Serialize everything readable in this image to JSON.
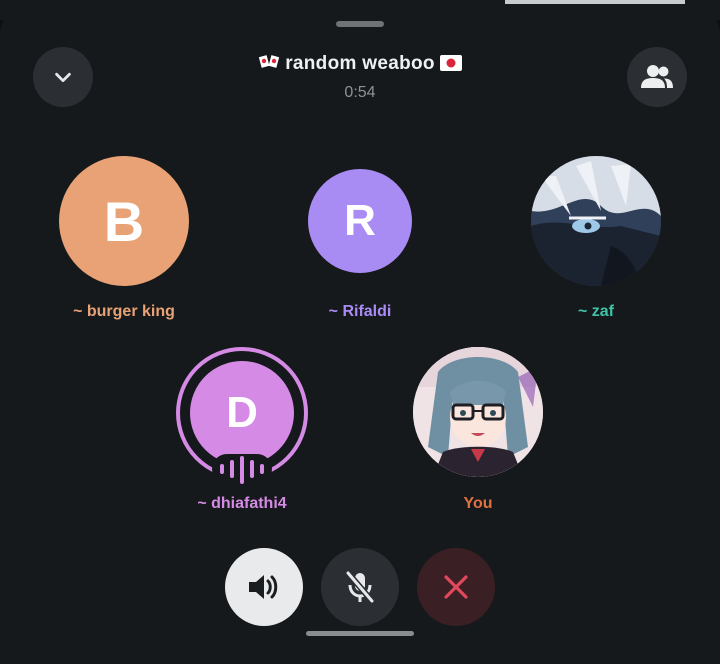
{
  "call": {
    "title": "random weaboo",
    "timer": "0:54"
  },
  "participants": [
    {
      "initial": "B",
      "name": "~ burger king",
      "color": "#e8a275",
      "name_color": "#e8a275"
    },
    {
      "initial": "R",
      "name": "~ Rifaldi",
      "color": "#a98bf4",
      "name_color": "#a98bf4"
    },
    {
      "initial": "",
      "name": "~ zaf",
      "color": "#3a4a5e",
      "name_color": "#3fc3a8"
    },
    {
      "initial": "D",
      "name": "~ dhiafathi4",
      "color": "#d58be6",
      "name_color": "#d58be6",
      "speaking": true
    },
    {
      "initial": "",
      "name": "You",
      "color": "#e0d3d8",
      "name_color": "#e0703f"
    }
  ],
  "icons": {
    "minimize": "chevron-down-icon",
    "participants": "people-icon",
    "speaker": "speaker-icon",
    "mute": "mic-off-icon",
    "end": "close-icon"
  },
  "colors": {
    "speaker_bg": "#e9eaeb",
    "mute_bg": "#2b2f33",
    "end_bg": "#3a1f25",
    "end_icon": "#e1495b"
  }
}
